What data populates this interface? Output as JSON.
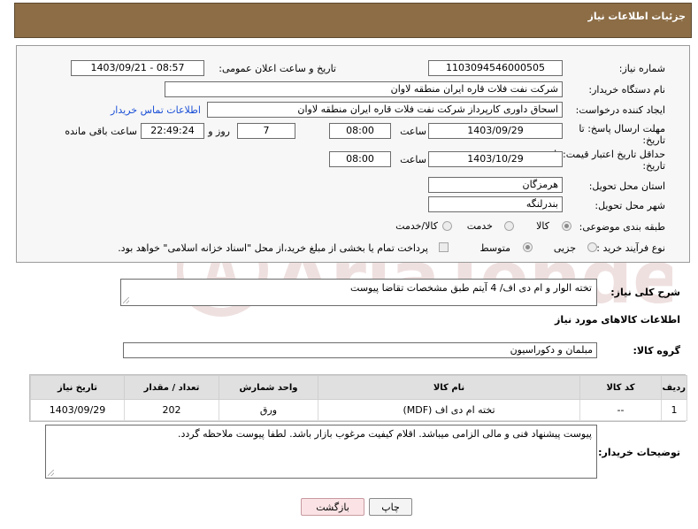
{
  "header": {
    "title": "جزئیات اطلاعات نیاز"
  },
  "form": {
    "need_number": {
      "label": "شماره نیاز:",
      "value": "1103094546000505"
    },
    "announce_datetime": {
      "label": "تاریخ و ساعت اعلان عمومی:",
      "value": "1403/09/21 - 08:57"
    },
    "buyer_org": {
      "label": "نام دستگاه خریدار:",
      "value": "شرکت نفت فلات قاره ایران منطقه لاوان"
    },
    "requester": {
      "label": "ایجاد کننده درخواست:",
      "value": "اسحاق داوری کارپرداز شرکت نفت فلات قاره ایران منطقه لاوان",
      "contact_link": "اطلاعات تماس خریدار"
    },
    "reply_deadline": {
      "label_line1": "مهلت ارسال پاسخ: تا",
      "label_line2": "تاریخ:",
      "date": "1403/09/29",
      "time_label": "ساعت",
      "time": "08:00",
      "days": "7",
      "days_label": "روز و",
      "remaining": "22:49:24",
      "remaining_label": "ساعت باقی مانده"
    },
    "price_validity": {
      "label_line1": "حداقل تاریخ اعتبار قیمت: تا",
      "label_line2": "تاریخ:",
      "date": "1403/10/29",
      "time_label": "ساعت",
      "time": "08:00"
    },
    "delivery_province": {
      "label": "استان محل تحویل:",
      "value": "هرمزگان"
    },
    "delivery_city": {
      "label": "شهر محل تحویل:",
      "value": "بندرلنگه"
    },
    "category": {
      "label": "طبقه بندی موضوعی:",
      "options": [
        "کالا",
        "خدمت",
        "کالا/خدمت"
      ],
      "selected": "کالا"
    },
    "purchase_type": {
      "label": "نوع فرآیند خرید :",
      "options": [
        "جزیی",
        "متوسط"
      ],
      "selected": "متوسط",
      "payment_note": "پرداخت تمام یا بخشی از مبلغ خرید،از محل \"اسناد خزانه اسلامی\" خواهد بود."
    }
  },
  "summary": {
    "label": "شرح کلی نیاز:",
    "value": "تخته الوار و ام دی اف/ 4 آیتم طبق مشخصات تقاضا پیوست"
  },
  "goods_info": {
    "section_title": "اطلاعات کالاهای مورد نیاز",
    "group_label": "گروه کالا:",
    "group_value": "مبلمان و دکوراسیون"
  },
  "table": {
    "headers": [
      "ردیف",
      "کد کالا",
      "نام کالا",
      "واحد شمارش",
      "تعداد / مقدار",
      "تاریخ نیاز"
    ],
    "rows": [
      {
        "row": "1",
        "code": "--",
        "name": "تخته ام دی اف (MDF)",
        "unit": "ورق",
        "qty": "202",
        "date": "1403/09/29"
      }
    ]
  },
  "buyer_notes": {
    "label": "توضیحات خریدار:",
    "value": "پیوست پیشنهاد فنی و مالی الزامی میباشد. اقلام کیفیت مرغوب بازار باشد. لطفا پیوست ملاحظه گردد."
  },
  "buttons": {
    "print": "چاپ",
    "back": "بازگشت"
  },
  "colors": {
    "header_bg": "#8c6d46",
    "link": "#1a4fd6",
    "back_button_bg": "#fbe3e5"
  },
  "watermark": "AriaTender.neT"
}
